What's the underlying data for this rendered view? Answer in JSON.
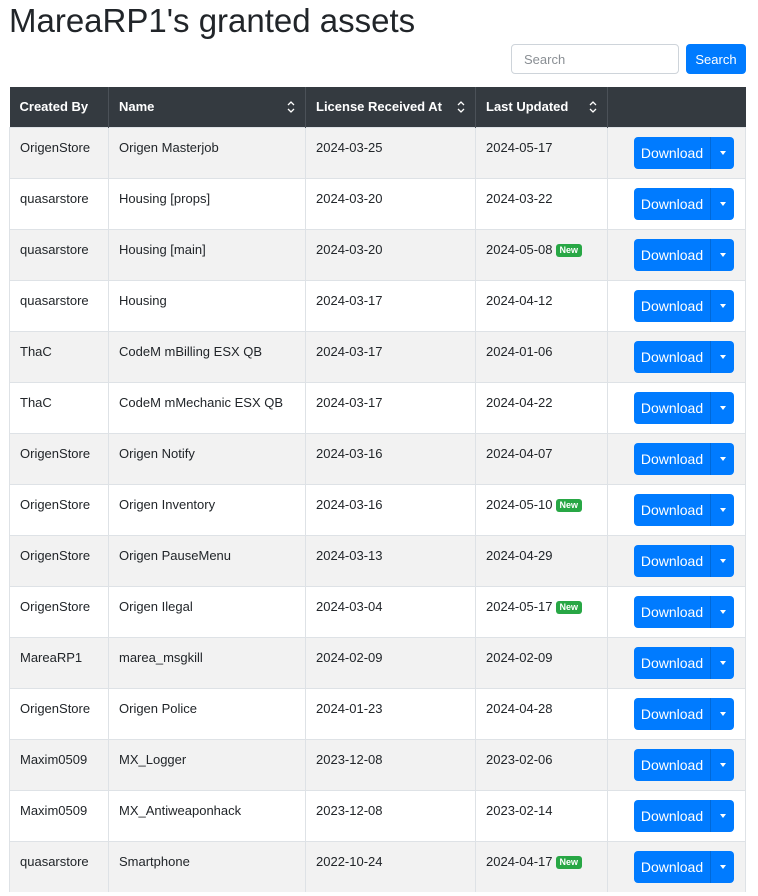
{
  "page": {
    "title": "MareaRP1's granted assets"
  },
  "search": {
    "placeholder": "Search",
    "value": "",
    "button_label": "Search"
  },
  "table": {
    "columns": [
      {
        "label": "Created By",
        "sortable": false
      },
      {
        "label": "Name",
        "sortable": true
      },
      {
        "label": "License Received At",
        "sortable": true
      },
      {
        "label": "Last Updated",
        "sortable": true
      },
      {
        "label": "",
        "sortable": false
      }
    ],
    "download_label": "Download",
    "new_badge_label": "New",
    "rows": [
      {
        "created_by": "OrigenStore",
        "name": "Origen Masterjob",
        "license_received": "2024-03-25",
        "last_updated": "2024-05-17",
        "is_new": false
      },
      {
        "created_by": "quasarstore",
        "name": "Housing [props]",
        "license_received": "2024-03-20",
        "last_updated": "2024-03-22",
        "is_new": false
      },
      {
        "created_by": "quasarstore",
        "name": "Housing [main]",
        "license_received": "2024-03-20",
        "last_updated": "2024-05-08",
        "is_new": true
      },
      {
        "created_by": "quasarstore",
        "name": "Housing",
        "license_received": "2024-03-17",
        "last_updated": "2024-04-12",
        "is_new": false
      },
      {
        "created_by": "ThaC",
        "name": "CodeM mBilling ESX QB",
        "license_received": "2024-03-17",
        "last_updated": "2024-01-06",
        "is_new": false
      },
      {
        "created_by": "ThaC",
        "name": "CodeM mMechanic ESX QB",
        "license_received": "2024-03-17",
        "last_updated": "2024-04-22",
        "is_new": false
      },
      {
        "created_by": "OrigenStore",
        "name": "Origen Notify",
        "license_received": "2024-03-16",
        "last_updated": "2024-04-07",
        "is_new": false
      },
      {
        "created_by": "OrigenStore",
        "name": "Origen Inventory",
        "license_received": "2024-03-16",
        "last_updated": "2024-05-10",
        "is_new": true
      },
      {
        "created_by": "OrigenStore",
        "name": "Origen PauseMenu",
        "license_received": "2024-03-13",
        "last_updated": "2024-04-29",
        "is_new": false
      },
      {
        "created_by": "OrigenStore",
        "name": "Origen Ilegal",
        "license_received": "2024-03-04",
        "last_updated": "2024-05-17",
        "is_new": true
      },
      {
        "created_by": "MareaRP1",
        "name": "marea_msgkill",
        "license_received": "2024-02-09",
        "last_updated": "2024-02-09",
        "is_new": false
      },
      {
        "created_by": "OrigenStore",
        "name": "Origen Police",
        "license_received": "2024-01-23",
        "last_updated": "2024-04-28",
        "is_new": false
      },
      {
        "created_by": "Maxim0509",
        "name": "MX_Logger",
        "license_received": "2023-12-08",
        "last_updated": "2023-02-06",
        "is_new": false
      },
      {
        "created_by": "Maxim0509",
        "name": "MX_Antiweaponhack",
        "license_received": "2023-12-08",
        "last_updated": "2023-02-14",
        "is_new": false
      },
      {
        "created_by": "quasarstore",
        "name": "Smartphone",
        "license_received": "2022-10-24",
        "last_updated": "2024-04-17",
        "is_new": true
      }
    ]
  },
  "colors": {
    "primary": "#007bff",
    "header_bg": "#343a40",
    "badge_new": "#28a745",
    "row_stripe": "#f2f2f2"
  },
  "icons": {
    "sort": "sort-updown-icon",
    "dropdown": "caret-down-icon"
  }
}
